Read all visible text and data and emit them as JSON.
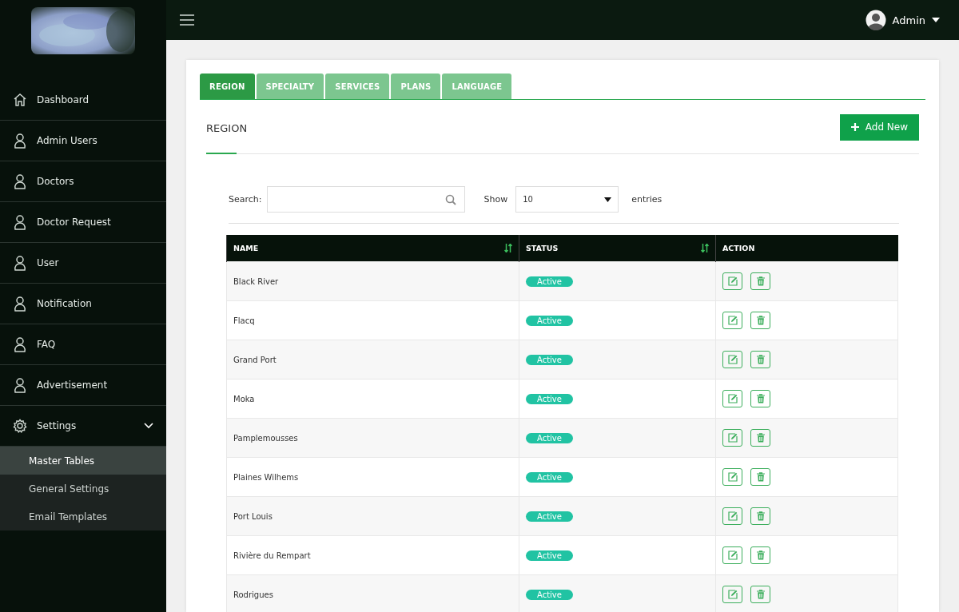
{
  "sidebar": {
    "items": [
      {
        "label": "Dashboard",
        "kind": "home"
      },
      {
        "label": "Admin Users",
        "kind": "user"
      },
      {
        "label": "Doctors",
        "kind": "user"
      },
      {
        "label": "Doctor Request",
        "kind": "user"
      },
      {
        "label": "User",
        "kind": "user"
      },
      {
        "label": "Notification",
        "kind": "user"
      },
      {
        "label": "FAQ",
        "kind": "user"
      },
      {
        "label": "Advertisement",
        "kind": "user"
      },
      {
        "label": "Settings",
        "kind": "gear",
        "expanded": true,
        "children": [
          {
            "label": "Master Tables",
            "selected": true
          },
          {
            "label": "General Settings",
            "selected": false
          },
          {
            "label": "Email Templates",
            "selected": false
          }
        ]
      }
    ]
  },
  "topbar": {
    "user": "Admin"
  },
  "tabs": [
    {
      "label": "REGION",
      "selected": true
    },
    {
      "label": "SPECIALTY",
      "selected": false
    },
    {
      "label": "SERVICES",
      "selected": false
    },
    {
      "label": "PLANS",
      "selected": false
    },
    {
      "label": "LANGUAGE",
      "selected": false
    }
  ],
  "section": {
    "title": "REGION",
    "add_button": "Add New"
  },
  "filters": {
    "search_label": "Search:",
    "show_label": "Show",
    "page_size": "10",
    "entries_label": "entries"
  },
  "table": {
    "columns": [
      {
        "label": "NAME",
        "sortable": true
      },
      {
        "label": "STATUS",
        "sortable": true
      },
      {
        "label": "ACTION",
        "sortable": false
      }
    ],
    "rows": [
      {
        "name": "Black River",
        "status": "Active"
      },
      {
        "name": "Flacq",
        "status": "Active"
      },
      {
        "name": "Grand Port",
        "status": "Active"
      },
      {
        "name": "Moka",
        "status": "Active"
      },
      {
        "name": "Pamplemousses",
        "status": "Active"
      },
      {
        "name": "Plaines Wilhems",
        "status": "Active"
      },
      {
        "name": "Port Louis",
        "status": "Active"
      },
      {
        "name": "Rivière du Rempart",
        "status": "Active"
      },
      {
        "name": "Rodrigues",
        "status": "Active"
      }
    ]
  }
}
